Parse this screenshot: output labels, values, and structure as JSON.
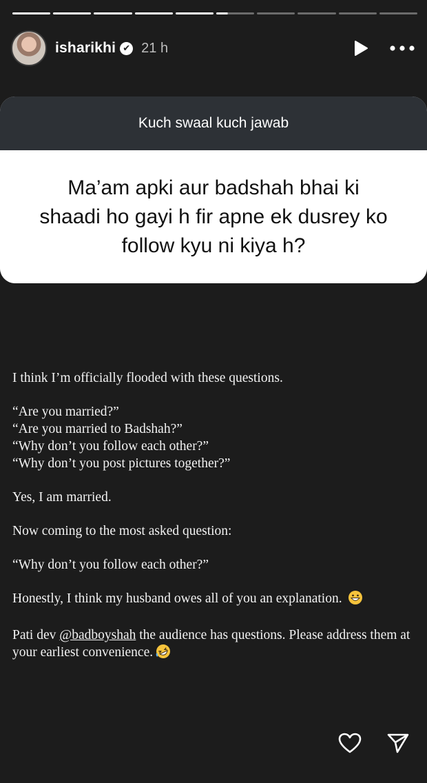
{
  "progress": {
    "total_segments": 10,
    "completed": 5,
    "current_fraction": 0.3
  },
  "header": {
    "username": "isharikhi",
    "verified_mark": "✔",
    "time": "21 h",
    "icons": [
      "play-icon",
      "more-icon"
    ]
  },
  "question_box": {
    "title": "Kuch swaal kuch jawab",
    "question": "Ma’am apki aur badshah bhai ki shaadi ho gayi h fir apne ek dusrey ko follow kyu ni kiya h?"
  },
  "caption": {
    "line1": "I think I’m officially flooded with these questions.",
    "q1": "“Are you married?”",
    "q2": "“Are you married to Badshah?”",
    "q3": "“Why don’t you follow each other?”",
    "q4": "“Why don’t you post pictures together?”",
    "line2": "Yes, I am married.",
    "line3": "Now coming to the most asked question:",
    "line4": "“Why don’t you follow each other?”",
    "line5": "Honestly, I think my husband owes all of you an explanation.",
    "line6_prefix": "Pati dev ",
    "mention": "@badboyshah",
    "line6_suffix": " the audience has questions. Please address them at your earliest convenience."
  },
  "actions": [
    "like-heart-icon",
    "share-send-icon"
  ],
  "colors": {
    "background": "#1c1c1c",
    "question_header": "#2d3136",
    "question_body": "#ffffff"
  }
}
